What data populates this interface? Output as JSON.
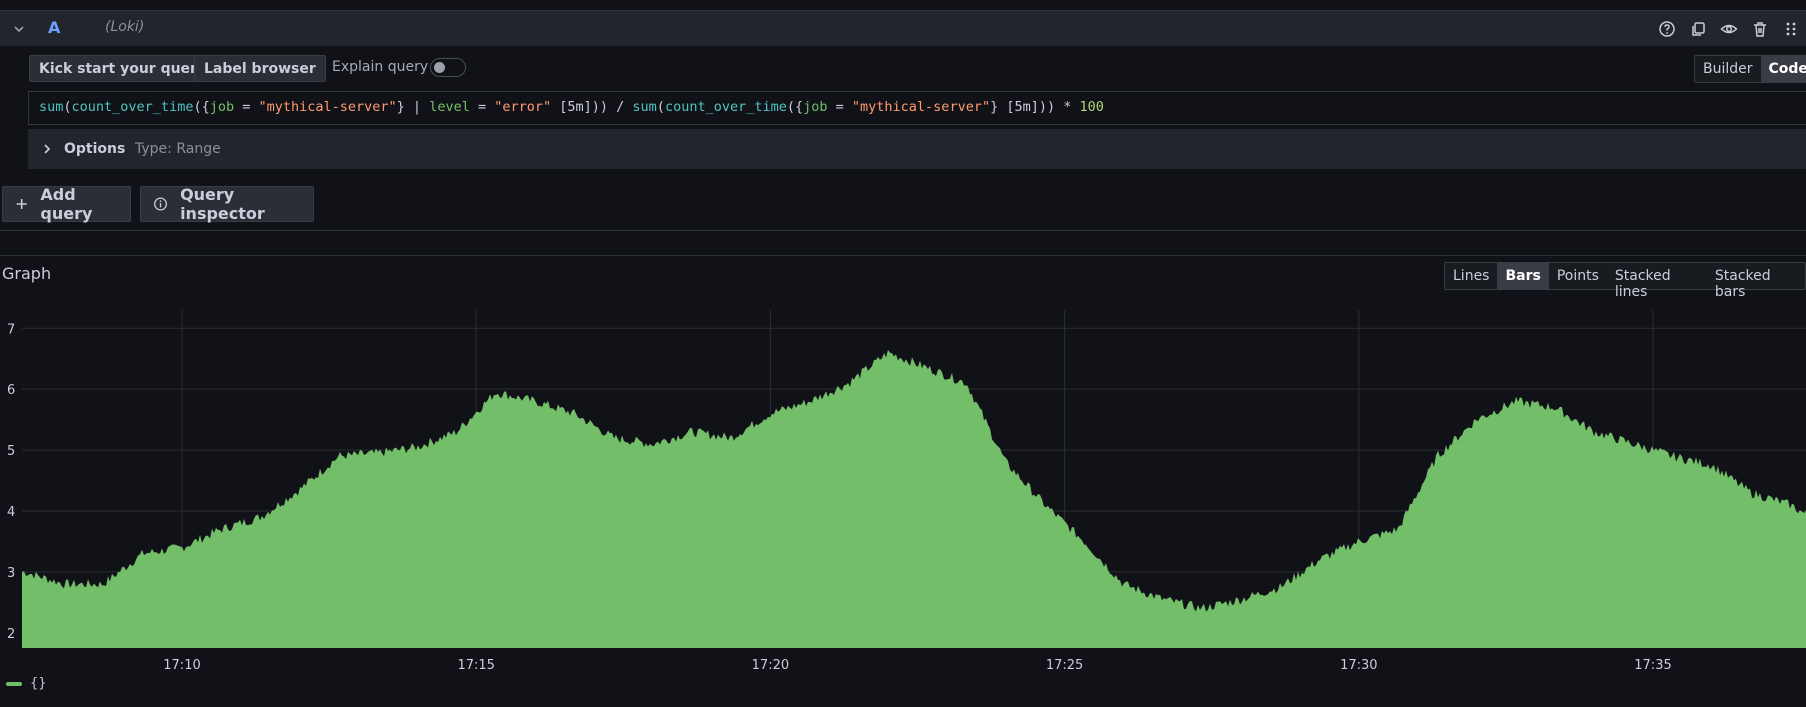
{
  "query_row": {
    "ref_id": "A",
    "datasource": "(Loki)"
  },
  "toolbar": {
    "kick_start": "Kick start your query",
    "label_browser": "Label browser",
    "explain_query": "Explain query",
    "explain_enabled": false,
    "mode_builder": "Builder",
    "mode_code": "Code",
    "active_mode": "Code"
  },
  "query": {
    "text": "sum(count_over_time({job = \"mythical-server\"} | level = \"error\" [5m])) / sum(count_over_time({job = \"mythical-server\"} [5m])) * 100"
  },
  "options": {
    "label": "Options",
    "type": "Type: Range"
  },
  "actions": {
    "add_query": "Add query",
    "query_inspector": "Query inspector"
  },
  "graph": {
    "title": "Graph",
    "modes": [
      "Lines",
      "Bars",
      "Points",
      "Stacked lines",
      "Stacked bars"
    ],
    "active_mode": "Bars",
    "legend": "{}"
  },
  "colors": {
    "accent_blue": "#6e9fff",
    "series_green": "#73bf69",
    "background": "#111217"
  },
  "chart_data": {
    "type": "area",
    "title": "",
    "xlabel": "",
    "ylabel": "",
    "x_ticks": [
      "17:10",
      "17:15",
      "17:20",
      "17:25",
      "17:30",
      "17:35"
    ],
    "y_ticks": [
      2,
      3,
      4,
      5,
      6,
      7
    ],
    "ylim": [
      1.75,
      7.3
    ],
    "x": [
      "17:07:20",
      "17:08:00",
      "17:08:40",
      "17:09:20",
      "17:10:00",
      "17:10:40",
      "17:11:20",
      "17:12:00",
      "17:12:40",
      "17:13:20",
      "17:14:00",
      "17:14:40",
      "17:15:20",
      "17:16:00",
      "17:16:40",
      "17:17:20",
      "17:18:00",
      "17:18:40",
      "17:19:20",
      "17:20:00",
      "17:20:40",
      "17:21:20",
      "17:22:00",
      "17:22:40",
      "17:23:20",
      "17:24:00",
      "17:24:40",
      "17:25:20",
      "17:26:00",
      "17:26:40",
      "17:27:20",
      "17:28:00",
      "17:28:40",
      "17:29:20",
      "17:30:00",
      "17:30:40",
      "17:31:20",
      "17:32:00",
      "17:32:40",
      "17:33:20",
      "17:34:00",
      "17:34:40",
      "17:35:20",
      "17:36:00",
      "17:36:40",
      "17:37:20",
      "17:37:40"
    ],
    "series": [
      {
        "values": [
          3.0,
          2.8,
          2.8,
          3.3,
          3.4,
          3.7,
          3.9,
          4.35,
          4.9,
          4.95,
          5.05,
          5.3,
          5.95,
          5.8,
          5.6,
          5.2,
          5.1,
          5.3,
          5.2,
          5.6,
          5.8,
          6.1,
          6.6,
          6.35,
          6.1,
          4.8,
          4.1,
          3.5,
          2.8,
          2.55,
          2.4,
          2.55,
          2.75,
          3.2,
          3.5,
          3.7,
          4.9,
          5.5,
          5.8,
          5.7,
          5.3,
          5.1,
          4.9,
          4.75,
          4.3,
          4.1,
          3.9
        ]
      }
    ]
  }
}
